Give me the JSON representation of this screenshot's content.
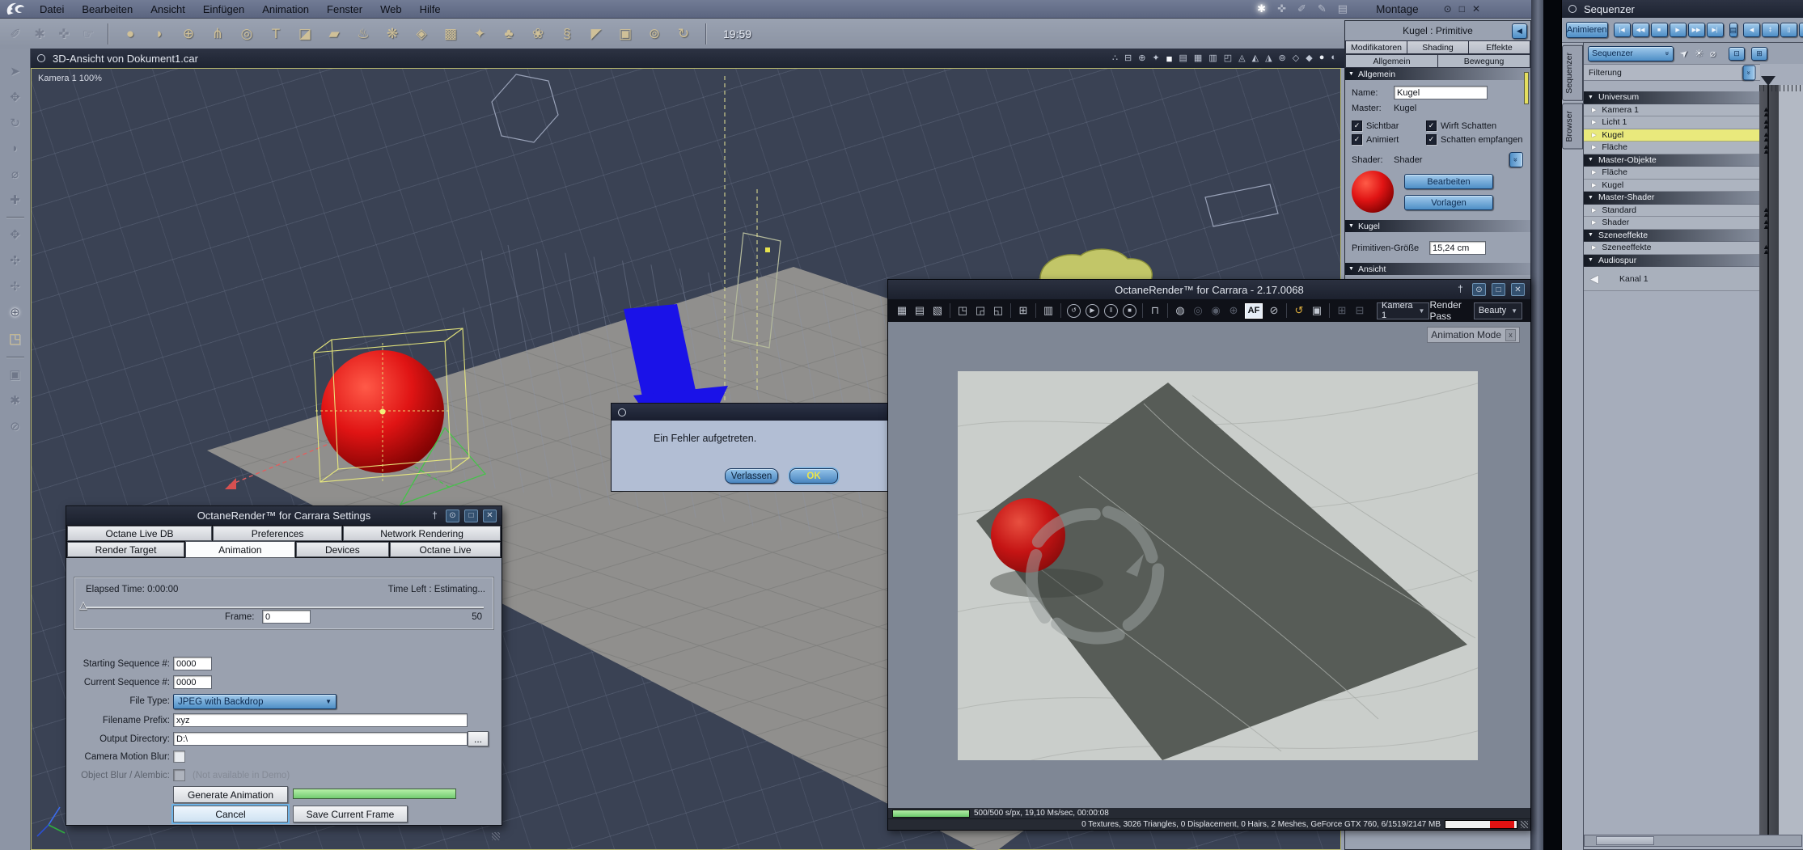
{
  "colors": {
    "selection_yellow": "#e9e97c",
    "sphere_red": "#cc1111",
    "arrow_blue": "#1a12e8",
    "progress_green": "#86d97e",
    "memory_red": "#e01212",
    "button_blue": "#5d9bd3"
  },
  "window_controls": {
    "pin": "†",
    "eye": "⊙",
    "max": "□",
    "close": "✕"
  },
  "menu_bar": {
    "menus": [
      "Datei",
      "Bearbeiten",
      "Ansicht",
      "Einfügen",
      "Animation",
      "Fenster",
      "Web",
      "Hilfe"
    ],
    "room_icons": [
      {
        "name": "assemble-room-icon",
        "glyph": "✱",
        "cls": "active"
      },
      {
        "name": "model-room-icon",
        "glyph": "✜",
        "cls": ""
      },
      {
        "name": "storyboard-room-icon",
        "glyph": "✐",
        "cls": ""
      },
      {
        "name": "texture-room-icon",
        "glyph": "✎",
        "cls": ""
      },
      {
        "name": "render-room-icon",
        "glyph": "▤",
        "cls": ""
      }
    ],
    "mode_label": "Montage",
    "time": "19:59"
  },
  "top_tools": {
    "edit_tools": [
      {
        "name": "lasso-tool",
        "glyph": "✐"
      },
      {
        "name": "pan-hand-tool",
        "glyph": "✱"
      },
      {
        "name": "adjust-tool",
        "glyph": "✜"
      },
      {
        "name": "push-tool",
        "glyph": "☞"
      }
    ],
    "insert_tools": [
      {
        "name": "sphere-tool",
        "glyph": "●"
      },
      {
        "name": "vertex-object-tool",
        "glyph": "◗"
      },
      {
        "name": "geometry-tool",
        "glyph": "⊕"
      },
      {
        "name": "bone-tool",
        "glyph": "⋔"
      },
      {
        "name": "rotascope-tool",
        "glyph": "◎"
      },
      {
        "name": "text-tool",
        "glyph": "T"
      },
      {
        "name": "plane-tool",
        "glyph": "◪"
      },
      {
        "name": "terrain-tool",
        "glyph": "▰"
      },
      {
        "name": "fire-tool",
        "glyph": "♨"
      },
      {
        "name": "particles-tool",
        "glyph": "❋"
      },
      {
        "name": "metaball-tool",
        "glyph": "◈"
      },
      {
        "name": "replicator-tool",
        "glyph": "▩"
      },
      {
        "name": "surface-replicator-tool",
        "glyph": "✦"
      },
      {
        "name": "tree-tool",
        "glyph": "♣"
      },
      {
        "name": "plant-tool",
        "glyph": "❀"
      },
      {
        "name": "spring-tool",
        "glyph": "§"
      },
      {
        "name": "light-tool",
        "glyph": "◤"
      },
      {
        "name": "camera-tool",
        "glyph": "▣"
      },
      {
        "name": "target-helper-tool",
        "glyph": "⊚"
      },
      {
        "name": "motion-tool",
        "glyph": "↻"
      }
    ]
  },
  "left_tools": {
    "group1": [
      {
        "name": "select-tool",
        "glyph": "➤",
        "cls": ""
      },
      {
        "name": "move-tool",
        "glyph": "✥",
        "cls": ""
      },
      {
        "name": "rotate-tool",
        "glyph": "↻",
        "cls": ""
      },
      {
        "name": "scale-tool",
        "glyph": "◗",
        "cls": ""
      },
      {
        "name": "hotpoint-tool",
        "glyph": "⌀",
        "cls": ""
      },
      {
        "name": "link-tool",
        "glyph": "✚",
        "cls": ""
      }
    ],
    "group2": [
      {
        "name": "pan-camera-tool",
        "glyph": "✥",
        "cls": ""
      },
      {
        "name": "orbit-camera-tool",
        "glyph": "✣",
        "cls": ""
      },
      {
        "name": "sweep-camera-tool",
        "glyph": "✢",
        "cls": ""
      },
      {
        "name": "track-camera-tool",
        "glyph": "⊕",
        "cls": "active"
      },
      {
        "name": "working-box-tool",
        "glyph": "◳",
        "cls": "tan"
      }
    ],
    "group3": [
      {
        "name": "render-preview-tool",
        "glyph": "▣",
        "cls": ""
      },
      {
        "name": "hand-tool",
        "glyph": "✱",
        "cls": ""
      },
      {
        "name": "zoom-tool",
        "glyph": "⊘",
        "cls": ""
      }
    ]
  },
  "viewport": {
    "title": "3D-Ansicht von Dokument1.car",
    "camera_label": "Kamera 1 100%",
    "bar_icons": [
      {
        "name": "display-quality-icon",
        "glyph": "∴",
        "cls": ""
      },
      {
        "name": "hierarchy-icon",
        "glyph": "⊟",
        "cls": ""
      },
      {
        "name": "camera-group-icon",
        "glyph": "⊕",
        "cls": ""
      },
      {
        "name": "effects-icon",
        "glyph": "✦",
        "cls": ""
      },
      {
        "name": "single-pane-icon",
        "glyph": "■",
        "cls": "active"
      },
      {
        "name": "two-pane-icon",
        "glyph": "▤",
        "cls": ""
      },
      {
        "name": "four-pane-icon",
        "glyph": "▦",
        "cls": ""
      },
      {
        "name": "three-pane-icon",
        "glyph": "▥",
        "cls": ""
      },
      {
        "name": "corner-pane-icon",
        "glyph": "◰",
        "cls": ""
      },
      {
        "name": "wire-globe-icon",
        "glyph": "◬",
        "cls": ""
      },
      {
        "name": "wire-globe-alt-icon",
        "glyph": "◭",
        "cls": ""
      },
      {
        "name": "wire-globe-third-icon",
        "glyph": "◮",
        "cls": ""
      },
      {
        "name": "axis-mode-icon",
        "glyph": "⊚",
        "cls": ""
      },
      {
        "name": "wireframe-cube-icon",
        "glyph": "◇",
        "cls": ""
      },
      {
        "name": "solid-cube-icon",
        "glyph": "◆",
        "cls": ""
      },
      {
        "name": "shaded-sphere-icon",
        "glyph": "●",
        "cls": "bright"
      },
      {
        "name": "textured-sphere-icon",
        "glyph": "◐",
        "cls": ""
      }
    ]
  },
  "properties": {
    "header": "Kugel : Primitive",
    "tabs_row1": [
      "Modifikatoren",
      "Shading",
      "Effekte"
    ],
    "tabs_row2": [
      "Allgemein",
      "Bewegung"
    ],
    "allgemein": {
      "section_title": "Allgemein",
      "name_label": "Name:",
      "name_value": "Kugel",
      "master_label": "Master:",
      "master_value": "Kugel",
      "cb_sichtbar": "Sichtbar",
      "cb_animiert": "Animiert",
      "cb_wirft": "Wirft Schatten",
      "cb_schatten": "Schatten empfangen",
      "check_glyph": "✓",
      "shader_label": "Shader:",
      "shader_value": "Shader",
      "edit_button": "Bearbeiten",
      "templates_button": "Vorlagen"
    },
    "kugel": {
      "section_title": "Kugel",
      "size_label": "Primitiven-Größe",
      "size_value": "15,24 cm"
    },
    "ansicht": {
      "section_title": "Ansicht"
    }
  },
  "sequencer": {
    "window_title": "Sequenzer",
    "animate_button": "Animieren",
    "transport": [
      {
        "name": "go-start-button",
        "glyph": "|◀"
      },
      {
        "name": "rewind-button",
        "glyph": "◀◀"
      },
      {
        "name": "stop-button",
        "glyph": "■"
      },
      {
        "name": "play-button",
        "glyph": "▶"
      },
      {
        "name": "fast-forward-button",
        "glyph": "▶▶"
      },
      {
        "name": "go-end-button",
        "glyph": "▶|"
      }
    ],
    "clipboard_glyph": "▤",
    "key_nav": [
      {
        "name": "prev-key-button",
        "glyph": "◀"
      },
      {
        "name": "add-key-button",
        "glyph": "‡"
      },
      {
        "name": "delete-key-button",
        "glyph": "▯"
      },
      {
        "name": "next-key-button",
        "glyph": "▶"
      }
    ],
    "side_tabs": [
      "Sequenzer",
      "Browser"
    ],
    "view_dropdown": "Sequenzer",
    "dropdown_chevron": "»",
    "pointer_glyph": "➤",
    "light_glyph": "☀",
    "zoom_glyph": "⌀",
    "toggle1_glyph": "⊡",
    "toggle2_glyph": "⊞",
    "filter_label": "Filterung",
    "tree": [
      {
        "label": "Universum",
        "kind": "group",
        "keycls": ""
      },
      {
        "label": "Kamera 1",
        "kind": "item",
        "keycls": "key"
      },
      {
        "label": "Licht 1",
        "kind": "item",
        "keycls": "key"
      },
      {
        "label": "Kugel",
        "kind": "item sel",
        "keycls": "key"
      },
      {
        "label": "Fläche",
        "kind": "item",
        "keycls": "key"
      },
      {
        "label": "Master-Objekte",
        "kind": "group",
        "keycls": ""
      },
      {
        "label": "Fläche",
        "kind": "item",
        "keycls": ""
      },
      {
        "label": "Kugel",
        "kind": "item",
        "keycls": ""
      },
      {
        "label": "Master-Shader",
        "kind": "group",
        "keycls": ""
      },
      {
        "label": "Standard",
        "kind": "item",
        "keycls": "key"
      },
      {
        "label": "Shader",
        "kind": "item",
        "keycls": "key"
      },
      {
        "label": "Szeneeffekte",
        "kind": "group",
        "keycls": ""
      },
      {
        "label": "Szeneeffekte",
        "kind": "item",
        "keycls": "key"
      },
      {
        "label": "Audiospur",
        "kind": "group audio",
        "keycls": ""
      },
      {
        "label": "Kanal 1",
        "kind": "channel",
        "keycls": ""
      }
    ]
  },
  "render_window": {
    "title": "OctaneRender™ for Carrara - 2.17.0068",
    "toolbar": [
      {
        "name": "save-render-icon",
        "glyph": "▦",
        "cls": ""
      },
      {
        "name": "save-settings-icon",
        "glyph": "▤",
        "cls": ""
      },
      {
        "name": "export-image-icon",
        "glyph": "▧",
        "cls": ""
      },
      {
        "name": "sep",
        "glyph": "",
        "cls": "sep"
      },
      {
        "name": "copy-image-icon",
        "glyph": "◳",
        "cls": ""
      },
      {
        "name": "paste-image-icon",
        "glyph": "◲",
        "cls": ""
      },
      {
        "name": "clone-image-icon",
        "glyph": "◱",
        "cls": ""
      },
      {
        "name": "sep",
        "glyph": "",
        "cls": "sep"
      },
      {
        "name": "region-render-icon",
        "glyph": "⊞",
        "cls": ""
      },
      {
        "name": "sep",
        "glyph": "",
        "cls": "sep"
      },
      {
        "name": "material-book-icon",
        "glyph": "▥",
        "cls": ""
      },
      {
        "name": "sep",
        "glyph": "",
        "cls": "sep"
      },
      {
        "name": "restart-render-icon",
        "glyph": "↺",
        "cls": "circ"
      },
      {
        "name": "play-render-icon",
        "glyph": "▶",
        "cls": "circ"
      },
      {
        "name": "pause-render-icon",
        "glyph": "‖",
        "cls": "circ"
      },
      {
        "name": "stop-render-icon",
        "glyph": "■",
        "cls": "circ"
      },
      {
        "name": "sep",
        "glyph": "",
        "cls": "sep"
      },
      {
        "name": "lock-resolution-icon",
        "glyph": "⊓",
        "cls": ""
      },
      {
        "name": "sep",
        "glyph": "",
        "cls": "sep"
      },
      {
        "name": "color-wheel-icon",
        "glyph": "◍",
        "cls": ""
      },
      {
        "name": "gamma-icon",
        "glyph": "◎",
        "cls": "dim"
      },
      {
        "name": "exposure-icon",
        "glyph": "◉",
        "cls": "dim"
      },
      {
        "name": "white-balance-icon",
        "glyph": "⊕",
        "cls": "dim"
      },
      {
        "name": "af-button",
        "glyph": "AF",
        "cls": "af"
      },
      {
        "name": "focus-picker-icon",
        "glyph": "⊘",
        "cls": ""
      },
      {
        "name": "sep",
        "glyph": "",
        "cls": "sep"
      },
      {
        "name": "undo-icon",
        "glyph": "↺",
        "cls": "warn"
      },
      {
        "name": "snapshot-icon",
        "glyph": "▣",
        "cls": ""
      },
      {
        "name": "sep",
        "glyph": "",
        "cls": "sep"
      },
      {
        "name": "camera-export-icon",
        "glyph": "⊞",
        "cls": "dim"
      },
      {
        "name": "camera-import-icon",
        "glyph": "⊟",
        "cls": "dim"
      }
    ],
    "camera_select": "Kamera 1",
    "select_arrow": "▼",
    "render_pass_label": "Render Pass",
    "render_pass_select": "Beauty",
    "animation_mode_badge": "Animation Mode",
    "badge_close": "x",
    "progress_text": "500/500 s/px, 19,10 Ms/sec, 00:00:08",
    "stats_text": "0 Textures, 3026 Triangles, 0 Displacement, 0 Hairs, 2 Meshes, GeForce GTX 760, 6/1519/2147 MB"
  },
  "settings_dialog": {
    "title": "OctaneRender™ for Carrara Settings",
    "tabs_row1": [
      {
        "label": "Octane Live DB",
        "cls": "ta"
      },
      {
        "label": "Preferences",
        "cls": "tb"
      },
      {
        "label": "Network Rendering",
        "cls": "tc"
      }
    ],
    "tabs_row2": [
      {
        "label": "Render Target",
        "cls": "td"
      },
      {
        "label": "Animation",
        "cls": "te active"
      },
      {
        "label": "Devices",
        "cls": "tf"
      },
      {
        "label": "Octane Live",
        "cls": "tg"
      }
    ],
    "elapsed_label": "Elapsed Time: 0:00:00",
    "time_left_label": "Time Left : Estimating...",
    "slider_handle": "△",
    "frame_label": "Frame:",
    "frame_value": "0",
    "frame_max": "50",
    "starting_seq_label": "Starting Sequence #:",
    "starting_seq_value": "0000",
    "current_seq_label": "Current Sequence #:",
    "current_seq_value": "0000",
    "file_type_label": "File Type:",
    "file_type_value": "JPEG with Backdrop",
    "filename_prefix_label": "Filename Prefix:",
    "filename_prefix_value": "xyz",
    "output_dir_label": "Output Directory:",
    "output_dir_value": "D:\\",
    "browse_button": "...",
    "camera_blur_label": "Camera Motion Blur:",
    "object_blur_label": "Object Blur / Alembic:",
    "demo_note": "(Not available in Demo)",
    "generate_button": "Generate Animation",
    "cancel_button": "Cancel",
    "save_frame_button": "Save Current Frame"
  },
  "error_dialog": {
    "message": "Ein Fehler aufgetreten.",
    "leave_button": "Verlassen",
    "ok_button": "OK"
  }
}
